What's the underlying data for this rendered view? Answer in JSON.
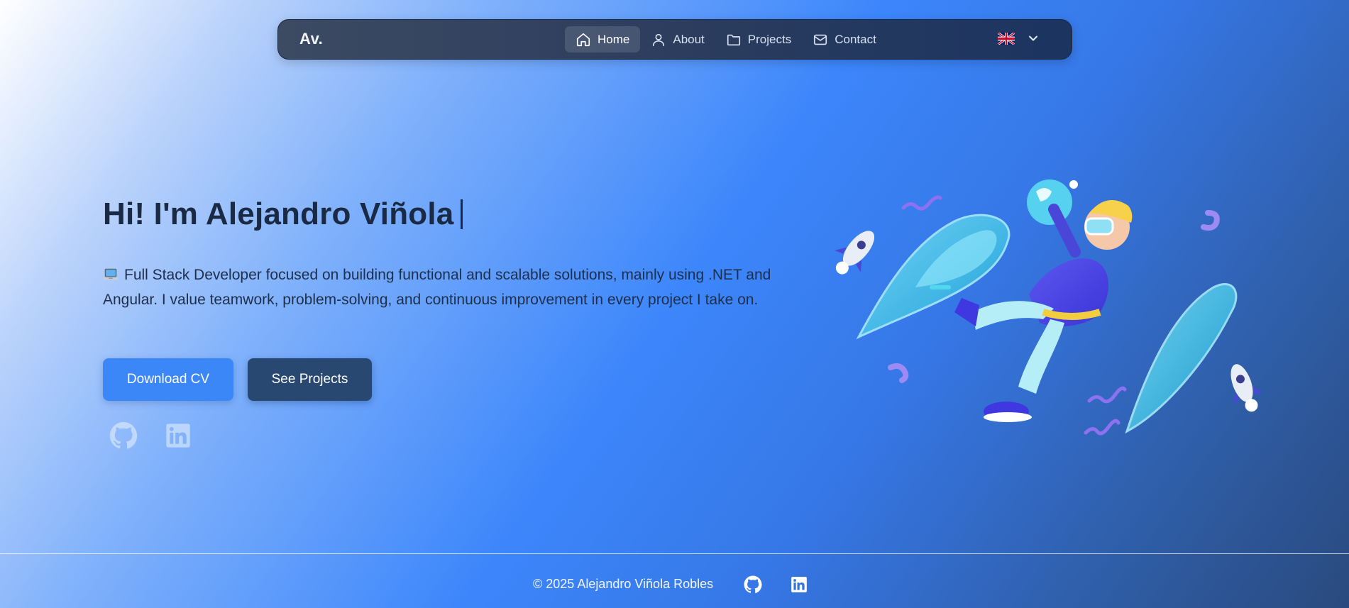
{
  "nav": {
    "brand": "Av.",
    "items": [
      {
        "label": "Home",
        "icon": "home-icon",
        "active": true
      },
      {
        "label": "About",
        "icon": "user-icon",
        "active": false
      },
      {
        "label": "Projects",
        "icon": "folder-icon",
        "active": false
      },
      {
        "label": "Contact",
        "icon": "mail-icon",
        "active": false
      }
    ],
    "language": {
      "icon": "uk-flag-icon",
      "dropdown_icon": "chevron-down-icon"
    }
  },
  "hero": {
    "title": "Hi! I'm Alejandro Viñola",
    "description": "Full Stack Developer focused on building functional and scalable solutions, mainly using .NET and Angular. I value teamwork, problem-solving, and continuous improvement in every project I take on.",
    "description_icon": "laptop-emoji-icon",
    "download_cv": "Download CV",
    "see_projects": "See Projects",
    "social": [
      "github-icon",
      "linkedin-icon"
    ],
    "illustration": "vr-astronaut-illustration"
  },
  "footer": {
    "copyright": "© 2025 Alejandro Viñola Robles",
    "social": [
      "github-icon",
      "linkedin-icon"
    ]
  },
  "colors": {
    "primary_button": "#3b87f8",
    "dark_button": "#284872",
    "navbar": "#2c3d5e",
    "title_text": "#1a2944"
  }
}
